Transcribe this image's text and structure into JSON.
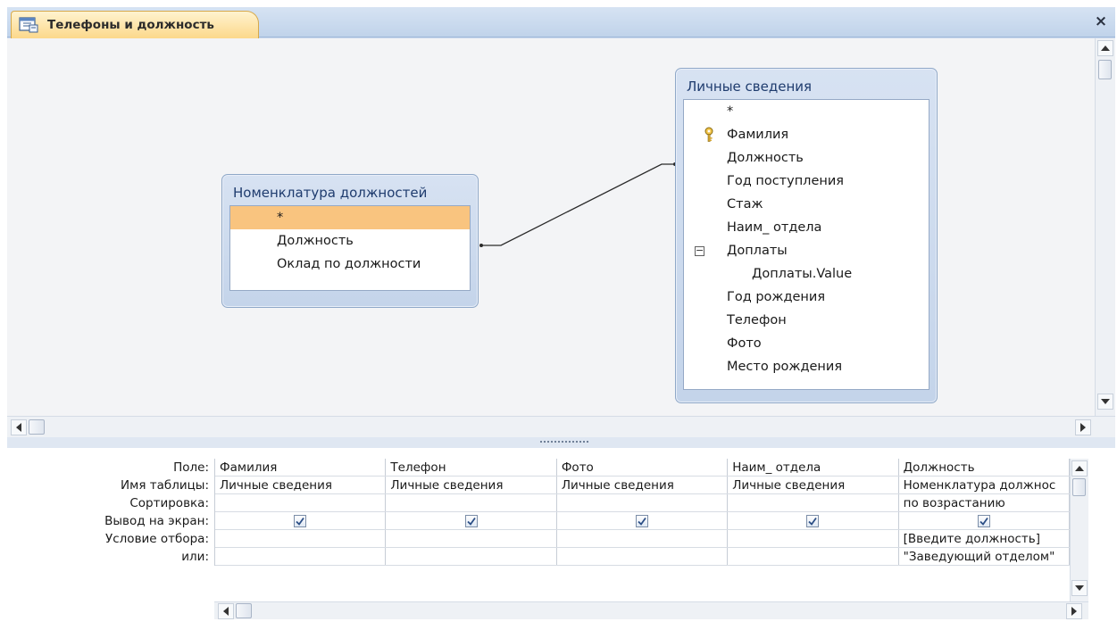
{
  "window": {
    "tab_title": "Телефоны и должность",
    "close_glyph": "×"
  },
  "tables": {
    "nomenclature": {
      "title": "Номенклатура должностей",
      "fields": [
        "*",
        "Должность",
        "Оклад по должности"
      ],
      "selected_field": "*"
    },
    "personal": {
      "title": "Личные сведения",
      "fields": [
        "*",
        "Фамилия",
        "Должность",
        "Год поступления",
        "Стаж",
        "Наим_ отдела",
        "Доплаты",
        "Доплаты.Value",
        "Год рождения",
        "Телефон",
        "Фото",
        "Место рождения"
      ],
      "primary_key_field": "Фамилия",
      "expander_glyph": "−"
    }
  },
  "design_grid": {
    "row_labels": [
      "Поле:",
      "Имя таблицы:",
      "Сортировка:",
      "Вывод на экран:",
      "Условие отбора:",
      "или:"
    ],
    "columns": [
      {
        "field": "Фамилия",
        "table": "Личные сведения",
        "sort": "",
        "show": true,
        "criteria": "",
        "or": ""
      },
      {
        "field": "Телефон",
        "table": "Личные сведения",
        "sort": "",
        "show": true,
        "criteria": "",
        "or": ""
      },
      {
        "field": "Фото",
        "table": "Личные сведения",
        "sort": "",
        "show": true,
        "criteria": "",
        "or": ""
      },
      {
        "field": "Наим_ отдела",
        "table": "Личные сведения",
        "sort": "",
        "show": true,
        "criteria": "",
        "or": ""
      },
      {
        "field": "Должность",
        "table": "Номенклатура должнос",
        "sort": "по возрастанию",
        "show": true,
        "criteria": "[Введите должность]",
        "or": "\"Заведующий отделом\""
      }
    ]
  },
  "icons": {
    "tab": "query-design-icon",
    "close": "close-icon",
    "key": "primary-key-icon",
    "checkbox": "checkmark-icon"
  },
  "colors": {
    "tab_bg": "#fcd88b",
    "selected_field": "#f9c47f",
    "list_title": "#1f3c6e",
    "frame": "#c9d8ec"
  }
}
